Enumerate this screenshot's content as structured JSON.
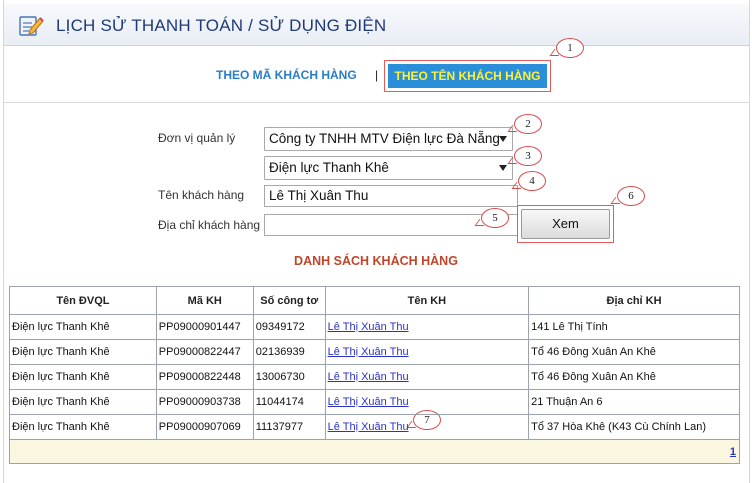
{
  "header": {
    "title": "LỊCH SỬ THANH TOÁN / SỬ DỤNG ĐIỆN",
    "icon": "edit-notepad-icon"
  },
  "tabs": {
    "by_code": "THEO MÃ KHÁCH HÀNG",
    "separator": "|",
    "by_name": "THEO TÊN KHÁCH HÀNG",
    "active": "by_name"
  },
  "form": {
    "unit_label": "Đơn vị quản lý",
    "unit_value": "Công ty TNHH MTV Điện lực Đà Nẵng",
    "subunit_value": "Điện lực Thanh Khê",
    "name_label": "Tên khách hàng",
    "name_value": "Lê Thị Xuân Thu",
    "address_label": "Địa chỉ khách hàng",
    "address_value": "",
    "submit_label": "Xem"
  },
  "callouts": [
    "1",
    "2",
    "3",
    "4",
    "5",
    "6",
    "7"
  ],
  "list": {
    "title": "DANH SÁCH KHÁCH HÀNG",
    "columns": [
      "Tên ĐVQL",
      "Mã KH",
      "Số công tơ",
      "Tên KH",
      "Địa chỉ KH"
    ],
    "rows": [
      [
        "Điện lực Thanh Khê",
        "PP09000901447",
        "09349172",
        "Lê Thị Xuân Thu",
        "141 Lê Thị Tính"
      ],
      [
        "Điện lực Thanh Khê",
        "PP09000822447",
        "02136939",
        "Lê Thị Xuân Thu",
        "Tổ 46 Đông Xuân An Khê"
      ],
      [
        "Điện lực Thanh Khê",
        "PP09000822448",
        "13006730",
        "Lê Thị Xuân Thu",
        "Tổ 46 Đông Xuân An Khê"
      ],
      [
        "Điện lực Thanh Khê",
        "PP09000903738",
        "11044174",
        "Lê Thị Xuân Thu",
        "21 Thuận An 6"
      ],
      [
        "Điện lực Thanh Khê",
        "PP09000907069",
        "11137977",
        "Lê Thị Xuân Thu",
        "Tổ 37 Hòa Khê (K43 Cù Chính Lan)"
      ]
    ],
    "page": "1"
  },
  "colors": {
    "header_text": "#1f3a78",
    "tab_link": "#2a7ec6",
    "tab_active_bg": "#2a8fd8",
    "tab_active_text": "#fff033",
    "list_title": "#c0452a",
    "callout_border": "#d94a4a",
    "pager_bg": "#fbf6df"
  }
}
